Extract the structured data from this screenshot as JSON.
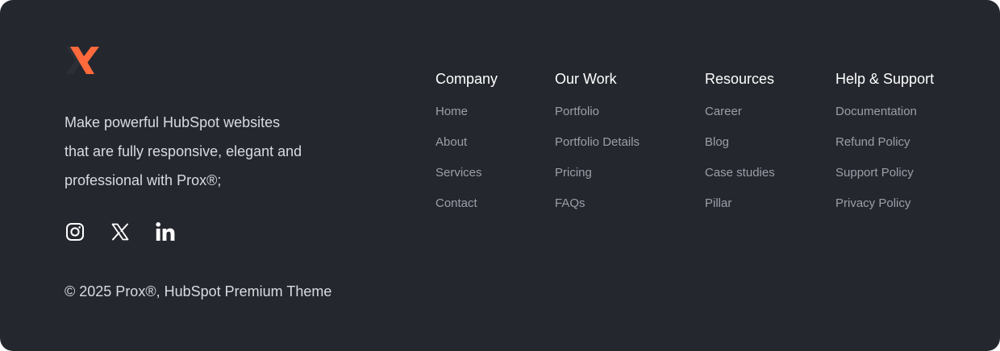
{
  "brand": {
    "logo_icon": "prox-x-logo",
    "accent_color": "#ff6a3d",
    "tagline_lines": [
      "Make powerful HubSpot websites",
      "that are fully responsive, elegant and",
      "professional with Prox®;"
    ]
  },
  "socials": [
    {
      "icon": "instagram-icon"
    },
    {
      "icon": "x-twitter-icon"
    },
    {
      "icon": "linkedin-icon"
    }
  ],
  "columns": [
    {
      "title": "Company",
      "links": [
        "Home",
        "About",
        "Services",
        "Contact"
      ]
    },
    {
      "title": "Our Work",
      "links": [
        "Portfolio",
        "Portfolio Details",
        "Pricing",
        "FAQs"
      ]
    },
    {
      "title": "Resources",
      "links": [
        "Career",
        "Blog",
        "Case studies",
        "Pillar"
      ]
    },
    {
      "title": "Help & Support",
      "links": [
        "Documentation",
        "Refund Policy",
        "Support Policy",
        "Privacy Policy"
      ]
    }
  ],
  "copyright": "© 2025 Prox®, HubSpot Premium Theme",
  "colors": {
    "background": "#24272e",
    "heading": "#ffffff",
    "link": "#9b9fa8",
    "body_text": "#d9dbe0"
  }
}
